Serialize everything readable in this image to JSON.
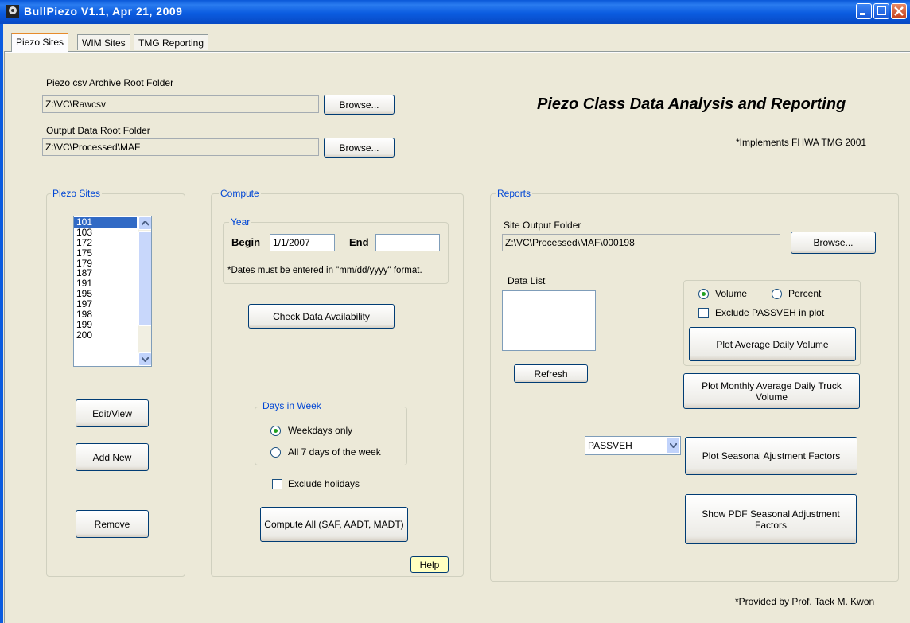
{
  "window": {
    "title": "BullPiezo V1.1, Apr 21, 2009"
  },
  "tabs": [
    {
      "label": "Piezo Sites",
      "active": true
    },
    {
      "label": "WIM Sites",
      "active": false
    },
    {
      "label": "TMG Reporting",
      "active": false
    }
  ],
  "header": {
    "archive_label": "Piezo csv Archive Root Folder",
    "archive_value": "Z:\\VC\\Rawcsv",
    "output_label": "Output Data Root Folder",
    "output_value": "Z:\\VC\\Processed\\MAF",
    "browse_label": "Browse...",
    "app_heading": "Piezo Class Data Analysis and Reporting",
    "implements_note": "*Implements FHWA TMG 2001"
  },
  "piezo_sites": {
    "title": "Piezo Sites",
    "items": [
      "101",
      "103",
      "172",
      "175",
      "179",
      "187",
      "191",
      "195",
      "197",
      "198",
      "199",
      "200"
    ],
    "selected": "101",
    "edit_label": "Edit/View",
    "add_label": "Add New",
    "remove_label": "Remove"
  },
  "compute": {
    "title": "Compute",
    "year_title": "Year",
    "begin_label": "Begin",
    "begin_value": "1/1/2007",
    "end_label": "End",
    "end_value": "",
    "date_note": "*Dates must be entered in \"mm/dd/yyyy\" format.",
    "check_label": "Check Data Availability",
    "days_title": "Days in Week",
    "weekdays_label": "Weekdays only",
    "all_days_label": "All 7 days of the week",
    "days_selected": "Weekdays only",
    "exclude_holidays_label": "Exclude holidays",
    "exclude_holidays_checked": false,
    "compute_all_label": "Compute All (SAF, AADT, MADT)",
    "help_label": "Help"
  },
  "reports": {
    "title": "Reports",
    "site_folder_label": "Site Output Folder",
    "site_folder_value": "Z:\\VC\\Processed\\MAF\\000198",
    "browse_label": "Browse...",
    "data_list_label": "Data List",
    "refresh_label": "Refresh",
    "volume_label": "Volume",
    "percent_label": "Percent",
    "mode_selected": "Volume",
    "exclude_passveh_label": "Exclude PASSVEH in plot",
    "exclude_passveh_checked": false,
    "plot_avg_daily_label": "Plot Average Daily Volume",
    "plot_monthly_label": "Plot Monthly Average Daily Truck Volume",
    "vehicle_class_value": "PASSVEH",
    "plot_seasonal_label": "Plot Seasonal Ajustment Factors",
    "show_pdf_label": "Show PDF Seasonal Adjustment Factors"
  },
  "footer": {
    "credit": "*Provided by Prof. Taek M. Kwon"
  },
  "colors": {
    "titlebar": "#0b5ce0",
    "group_title": "#0046d5",
    "selection": "#316ac5",
    "window_bg": "#ece9d8"
  }
}
